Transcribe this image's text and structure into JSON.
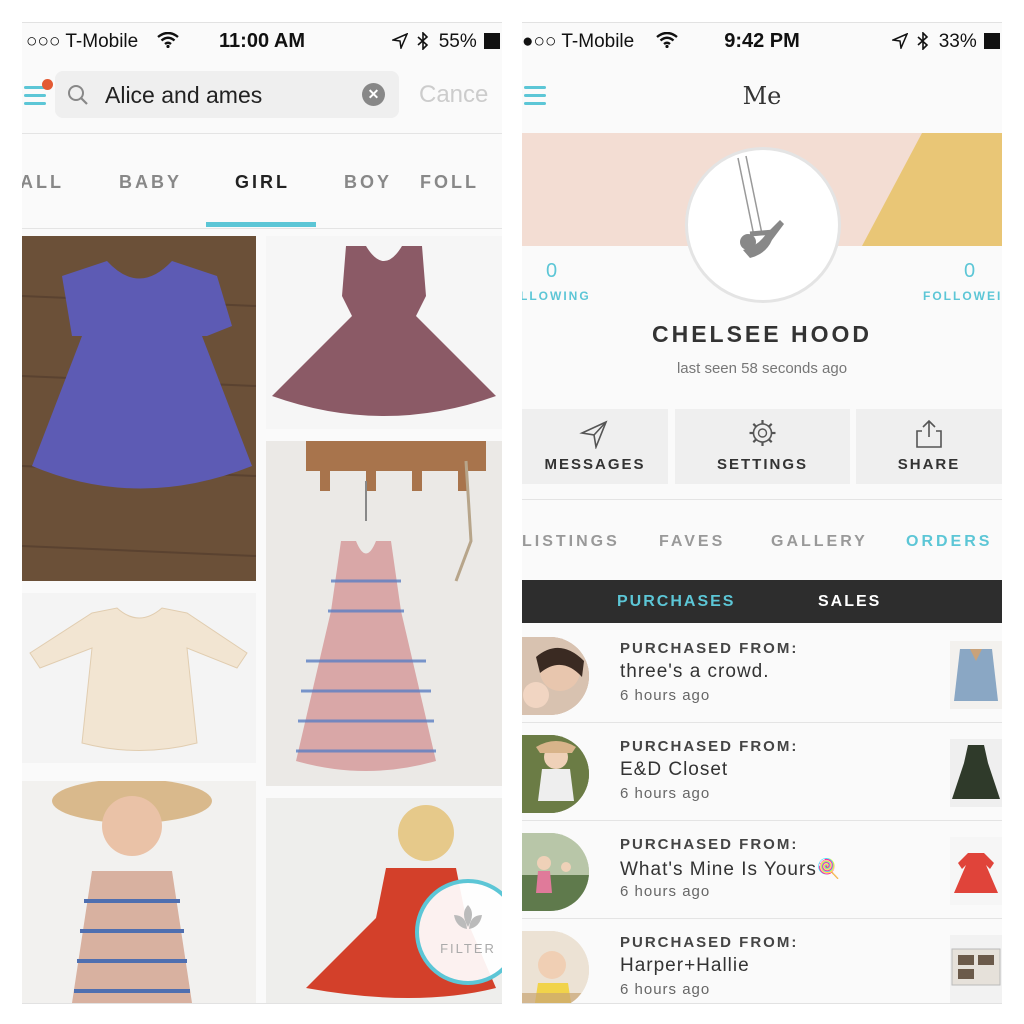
{
  "left_screen": {
    "status": {
      "carrier": "○○○ T-Mobile",
      "time": "11:00 AM",
      "battery": "55%"
    },
    "search": {
      "query": "Alice and ames",
      "cancel_label": "Cance"
    },
    "category_tabs": [
      {
        "label": "ALL"
      },
      {
        "label": "BABY"
      },
      {
        "label": "GIRL"
      },
      {
        "label": "BOY"
      },
      {
        "label": "FOLL"
      }
    ],
    "active_category": "GIRL",
    "products": [
      {
        "item": "purple short-sleeve twirl dress",
        "color": "#5d5bb4"
      },
      {
        "item": "mauve sleeveless twirl dress",
        "color": "#8b5a66"
      },
      {
        "item": "red white blue striped sleeveless dress",
        "color": "#c97b80"
      },
      {
        "item": "cream print long-sleeve peplum top",
        "color": "#f2e5d2"
      },
      {
        "item": "girl in striped dress with sun hat",
        "color": "#d8b1a0"
      },
      {
        "item": "girl twirling in red dress",
        "color": "#d3402a"
      }
    ],
    "filter_label": "FILTER",
    "accent_color": "#5cc6d6",
    "badge_color": "#e35a33"
  },
  "right_screen": {
    "status": {
      "carrier": "●○○ T-Mobile",
      "time": "9:42 PM",
      "battery": "33%"
    },
    "title": "Me",
    "stats": {
      "following": {
        "count": "0",
        "label": "LLOWING"
      },
      "followers": {
        "count": "0",
        "label": "FOLLOWEI"
      }
    },
    "username": "CHELSEE HOOD",
    "last_seen": "last seen 58 seconds ago",
    "actions": [
      {
        "label": "MESSAGES",
        "icon": "paper-plane-icon"
      },
      {
        "label": "SETTINGS",
        "icon": "gear-icon"
      },
      {
        "label": "SHARE",
        "icon": "share-icon"
      }
    ],
    "profile_tabs": [
      {
        "label": "LISTINGS"
      },
      {
        "label": "FAVES"
      },
      {
        "label": "GALLERY"
      },
      {
        "label": "ORDERS"
      }
    ],
    "active_profile_tab": "ORDERS",
    "segments": {
      "purchases": "PURCHASES",
      "sales": "SALES"
    },
    "orders": [
      {
        "title": "PURCHASED FROM:",
        "seller": "three's a crowd.",
        "time": "6 hours ago",
        "thumb_color": "#8aa7c4"
      },
      {
        "title": "PURCHASED FROM:",
        "seller": "E&D Closet",
        "time": "6 hours ago",
        "thumb_color": "#2f3a2a"
      },
      {
        "title": "PURCHASED FROM:",
        "seller": "What's Mine Is Yours🍭",
        "time": "6 hours ago",
        "thumb_color": "#e0443a"
      },
      {
        "title": "PURCHASED FROM:",
        "seller": "Harper+Hallie",
        "time": "6 hours ago",
        "thumb_color": "#6b5a4a"
      }
    ],
    "banner_colors": {
      "pink": "#f3ddd3",
      "mustard": "#e9c676"
    }
  }
}
